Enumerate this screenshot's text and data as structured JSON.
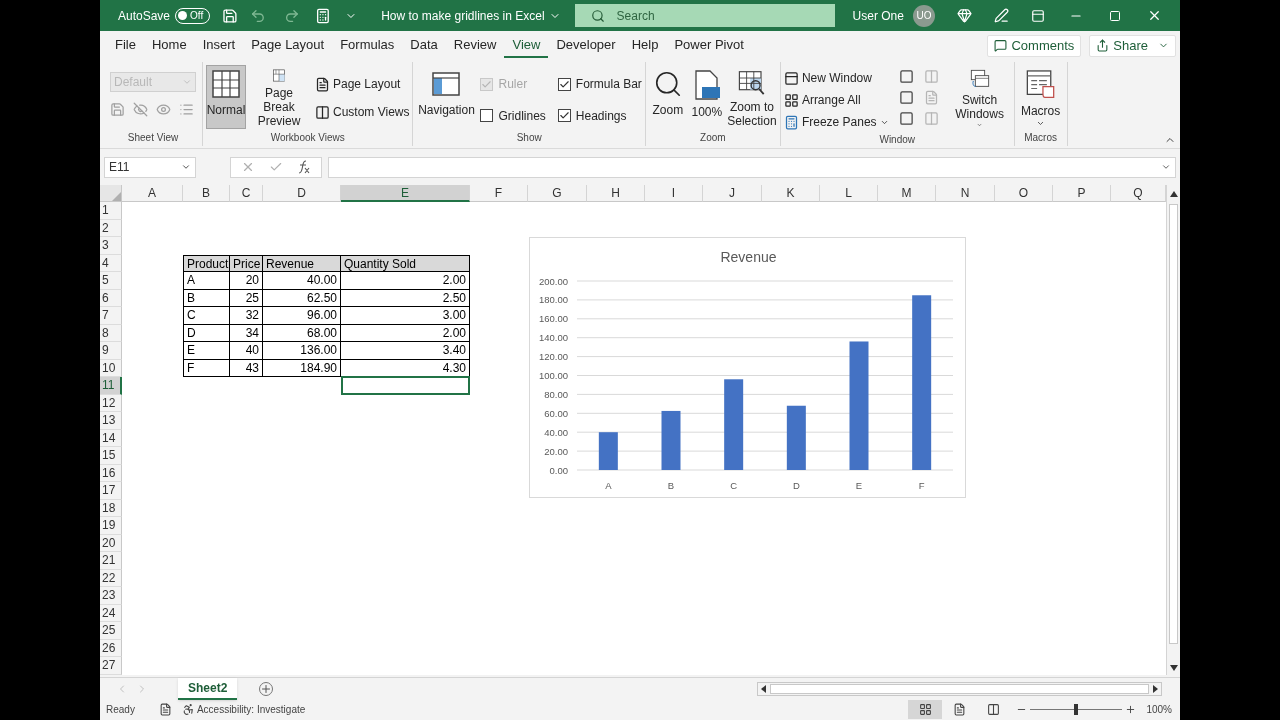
{
  "title_bar": {
    "autosave": {
      "label": "AutoSave",
      "state_text": "Off",
      "on": false
    },
    "document_title": "How to make gridlines in Excel",
    "search": {
      "placeholder": "Search"
    },
    "user": {
      "name": "User One",
      "initials": "UO"
    }
  },
  "ribbon_tabs": [
    {
      "label": "File",
      "selected": false
    },
    {
      "label": "Home",
      "selected": false
    },
    {
      "label": "Insert",
      "selected": false
    },
    {
      "label": "Page Layout",
      "selected": false
    },
    {
      "label": "Formulas",
      "selected": false
    },
    {
      "label": "Data",
      "selected": false
    },
    {
      "label": "Review",
      "selected": false
    },
    {
      "label": "View",
      "selected": true
    },
    {
      "label": "Developer",
      "selected": false
    },
    {
      "label": "Help",
      "selected": false
    },
    {
      "label": "Power Pivot",
      "selected": false
    }
  ],
  "comments_button": "Comments",
  "share_button": "Share",
  "ribbon_groups": [
    {
      "kind": "sheet_view",
      "label": "Sheet View",
      "dropdown": {
        "value": "Default",
        "disabled": true
      }
    },
    {
      "kind": "workbook_views",
      "label": "Workbook Views",
      "buttons": [
        {
          "label": "Normal",
          "selected": true,
          "menu": false
        },
        {
          "label": "Page Break Preview",
          "selected": false,
          "menu": false
        }
      ],
      "small_buttons": [
        {
          "label": "Page Layout",
          "menu": false
        },
        {
          "label": "Custom Views",
          "menu": false
        }
      ]
    },
    {
      "kind": "show",
      "label": "Show",
      "buttons": [
        {
          "label": "Navigation",
          "selected": false,
          "menu": false
        }
      ],
      "checkboxes": [
        {
          "label": "Ruler",
          "checked": true,
          "disabled": true
        },
        {
          "label": "Gridlines",
          "checked": false,
          "disabled": false
        },
        {
          "label": "Formula Bar",
          "checked": true,
          "disabled": false
        },
        {
          "label": "Headings",
          "checked": true,
          "disabled": false
        }
      ]
    },
    {
      "kind": "zoom",
      "label": "Zoom",
      "buttons": [
        {
          "label": "Zoom",
          "selected": false,
          "menu": false
        },
        {
          "label": "100%",
          "selected": false,
          "menu": false
        },
        {
          "label": "Zoom to Selection",
          "selected": false,
          "menu": false
        }
      ]
    },
    {
      "kind": "window",
      "label": "Window",
      "small_buttons": [
        {
          "label": "New Window",
          "menu": false
        },
        {
          "label": "Arrange All",
          "menu": false
        },
        {
          "label": "Freeze Panes",
          "menu": true
        }
      ],
      "buttons": [
        {
          "label": "Switch Windows",
          "selected": false,
          "menu": true
        }
      ]
    },
    {
      "kind": "macros",
      "label": "Macros",
      "buttons": [
        {
          "label": "Macros",
          "selected": false,
          "menu": true
        }
      ]
    }
  ],
  "formula_bar": {
    "name_box": "E11"
  },
  "sheet": {
    "columns": [
      {
        "label": "A",
        "selected": false
      },
      {
        "label": "B",
        "selected": false
      },
      {
        "label": "C",
        "selected": false
      },
      {
        "label": "D",
        "selected": false
      },
      {
        "label": "E",
        "selected": true
      },
      {
        "label": "F",
        "selected": false
      },
      {
        "label": "G",
        "selected": false
      },
      {
        "label": "H",
        "selected": false
      },
      {
        "label": "I",
        "selected": false
      },
      {
        "label": "J",
        "selected": false
      },
      {
        "label": "K",
        "selected": false
      },
      {
        "label": "L",
        "selected": false
      },
      {
        "label": "M",
        "selected": false
      },
      {
        "label": "N",
        "selected": false
      },
      {
        "label": "O",
        "selected": false
      },
      {
        "label": "P",
        "selected": false
      },
      {
        "label": "Q",
        "selected": false
      }
    ],
    "rows": [
      {
        "label": "1",
        "selected": false
      },
      {
        "label": "2",
        "selected": false
      },
      {
        "label": "3",
        "selected": false
      },
      {
        "label": "4",
        "selected": false
      },
      {
        "label": "5",
        "selected": false
      },
      {
        "label": "6",
        "selected": false
      },
      {
        "label": "7",
        "selected": false
      },
      {
        "label": "8",
        "selected": false
      },
      {
        "label": "9",
        "selected": false
      },
      {
        "label": "10",
        "selected": false
      },
      {
        "label": "11",
        "selected": true
      },
      {
        "label": "12",
        "selected": false
      },
      {
        "label": "13",
        "selected": false
      },
      {
        "label": "14",
        "selected": false
      },
      {
        "label": "15",
        "selected": false
      },
      {
        "label": "16",
        "selected": false
      },
      {
        "label": "17",
        "selected": false
      },
      {
        "label": "18",
        "selected": false
      },
      {
        "label": "19",
        "selected": false
      },
      {
        "label": "20",
        "selected": false
      },
      {
        "label": "21",
        "selected": false
      },
      {
        "label": "22",
        "selected": false
      },
      {
        "label": "23",
        "selected": false
      },
      {
        "label": "24",
        "selected": false
      },
      {
        "label": "25",
        "selected": false
      },
      {
        "label": "26",
        "selected": false
      },
      {
        "label": "27",
        "selected": false
      }
    ],
    "table": {
      "header": [
        "Product",
        "Price",
        "Revenue",
        "Quantity Sold"
      ],
      "rows": [
        [
          "A",
          "20",
          "40.00",
          "2.00"
        ],
        [
          "B",
          "25",
          "62.50",
          "2.50"
        ],
        [
          "C",
          "32",
          "96.00",
          "3.00"
        ],
        [
          "D",
          "34",
          "68.00",
          "2.00"
        ],
        [
          "E",
          "40",
          "136.00",
          "3.40"
        ],
        [
          "F",
          "43",
          "184.90",
          "4.30"
        ]
      ]
    },
    "chart_data": {
      "type": "bar",
      "title": "Revenue",
      "categories": [
        "A",
        "B",
        "C",
        "D",
        "E",
        "F"
      ],
      "series": [
        {
          "color": "#4472c4",
          "values": [
            40,
            62.5,
            96,
            68,
            136,
            184.9
          ]
        }
      ],
      "grid": true,
      "ylim": [
        0,
        200
      ],
      "yticks": [
        {
          "value": 0,
          "label": "0.00"
        },
        {
          "value": 20,
          "label": "20.00"
        },
        {
          "value": 40,
          "label": "40.00"
        },
        {
          "value": 60,
          "label": "60.00"
        },
        {
          "value": 80,
          "label": "80.00"
        },
        {
          "value": 100,
          "label": "100.00"
        },
        {
          "value": 120,
          "label": "120.00"
        },
        {
          "value": 140,
          "label": "140.00"
        },
        {
          "value": 160,
          "label": "160.00"
        },
        {
          "value": 180,
          "label": "180.00"
        },
        {
          "value": 200,
          "label": "200.00"
        }
      ]
    }
  },
  "sheet_tabs": [
    {
      "label": "Sheet2",
      "selected": true
    }
  ],
  "status_bar": {
    "ready": "Ready",
    "accessibility": "Accessibility: Investigate",
    "view_buttons": [
      {
        "selected": true
      },
      {
        "selected": false
      },
      {
        "selected": false
      }
    ],
    "zoom": {
      "level": 0.5,
      "reading": "100%"
    }
  }
}
